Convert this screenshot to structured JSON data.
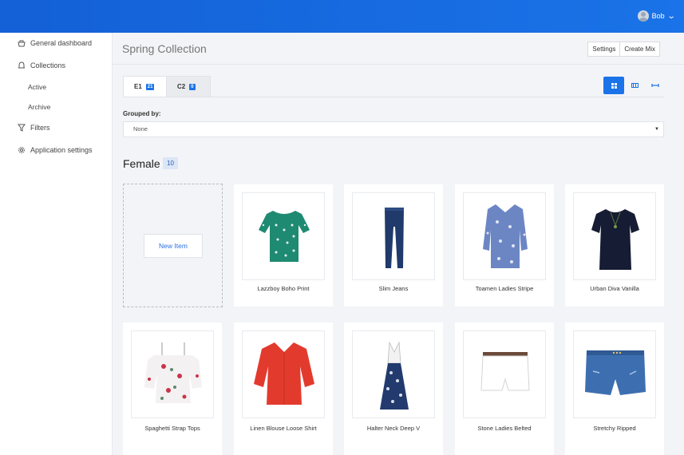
{
  "user": {
    "name": "Bob"
  },
  "sidebar": {
    "items": [
      {
        "label": "General dashboard",
        "icon": "dashboard-icon"
      },
      {
        "label": "Collections",
        "icon": "bell-icon"
      },
      {
        "label": "Active"
      },
      {
        "label": "Archive"
      },
      {
        "label": "Filters",
        "icon": "filter-icon"
      },
      {
        "label": "Application settings",
        "icon": "gear-icon"
      }
    ]
  },
  "header": {
    "title": "Spring Collection",
    "settings_label": "Settings",
    "create_mix_label": "Create Mix"
  },
  "tabs": [
    {
      "label": "E1",
      "count": "21"
    },
    {
      "label": "C2",
      "count": "0"
    }
  ],
  "view_modes": [
    "grid-view-icon",
    "columns-view-icon",
    "list-view-icon"
  ],
  "grouping": {
    "label": "Grouped by:",
    "value": "None"
  },
  "section": {
    "title": "Female",
    "count": "10"
  },
  "new_item_label": "New Item",
  "items": [
    {
      "name": "Lazzboy Boho Print"
    },
    {
      "name": "Slim Jeans"
    },
    {
      "name": "Toamen Ladies Stripe"
    },
    {
      "name": "Urban Diva Vanilla"
    },
    {
      "name": "Spaghetti Strap Tops"
    },
    {
      "name": "Linen Blouse Loose Shirt"
    },
    {
      "name": "Halter Neck Deep V"
    },
    {
      "name": "Stone Ladies Belted"
    },
    {
      "name": "Stretchy Ripped"
    }
  ],
  "colors": {
    "accent": "#1a73e8",
    "topbar": "#1460d6",
    "background": "#f3f4f7"
  }
}
